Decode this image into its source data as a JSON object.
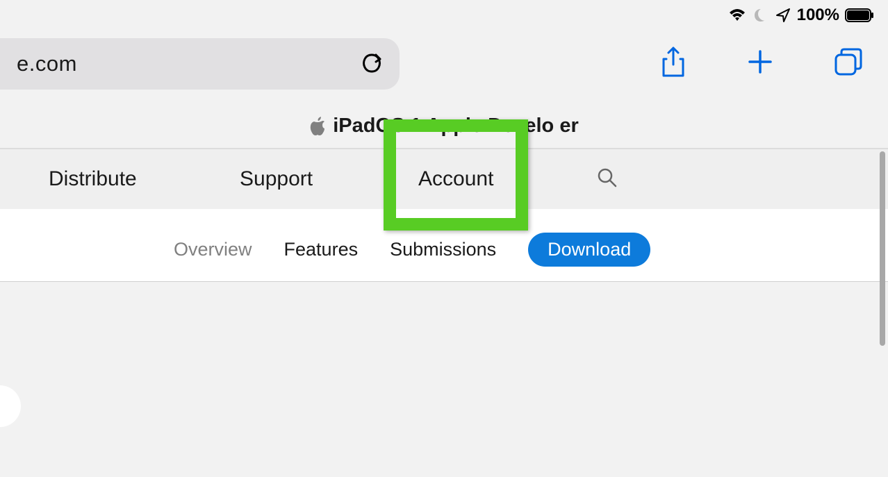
{
  "status": {
    "battery_percent": "100%"
  },
  "address_bar": {
    "url_fragment": "e.com"
  },
  "page_title": "iPadOS 1     Apple Develo    er",
  "nav": {
    "items": [
      {
        "label": "Distribute"
      },
      {
        "label": "Support"
      },
      {
        "label": "Account"
      }
    ]
  },
  "subnav": {
    "items": [
      {
        "label": "Overview",
        "active": true
      },
      {
        "label": "Features"
      },
      {
        "label": "Submissions"
      }
    ],
    "download_label": "Download"
  }
}
